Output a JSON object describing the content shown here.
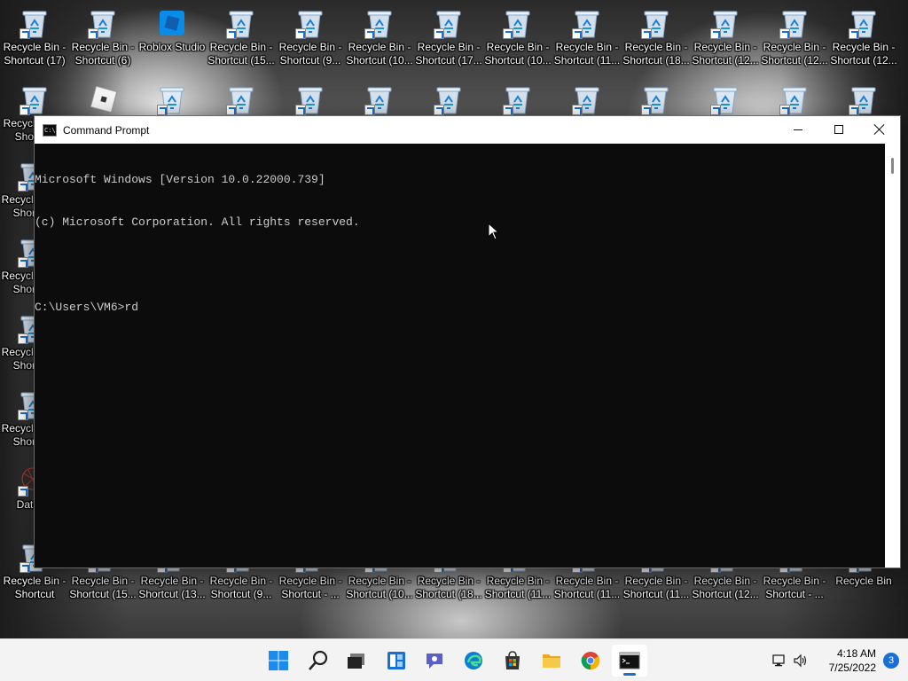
{
  "desktop": {
    "top_row": [
      {
        "label": "Recycle Bin -\nShortcut (17)",
        "icon": "recycle-bin-icon"
      },
      {
        "label": "Recycle Bin -\nShortcut (6)",
        "icon": "recycle-bin-icon"
      },
      {
        "label": "Roblox Studio",
        "icon": "roblox-studio-icon"
      },
      {
        "label": "Recycle Bin -\nShortcut (15...",
        "icon": "recycle-bin-icon"
      },
      {
        "label": "Recycle Bin -\nShortcut (9...",
        "icon": "recycle-bin-icon"
      },
      {
        "label": "Recycle Bin -\nShortcut (10...",
        "icon": "recycle-bin-icon"
      },
      {
        "label": "Recycle Bin -\nShortcut (17...",
        "icon": "recycle-bin-icon"
      },
      {
        "label": "Recycle Bin -\nShortcut (10...",
        "icon": "recycle-bin-icon"
      },
      {
        "label": "Recycle Bin -\nShortcut (11...",
        "icon": "recycle-bin-icon"
      },
      {
        "label": "Recycle Bin -\nShortcut (18...",
        "icon": "recycle-bin-icon"
      },
      {
        "label": "Recycle Bin -\nShortcut (12...",
        "icon": "recycle-bin-icon"
      },
      {
        "label": "Recycle Bin -\nShortcut (12...",
        "icon": "recycle-bin-icon"
      },
      {
        "label": "Recycle Bin -\nShortcut (12...",
        "icon": "recycle-bin-icon"
      }
    ],
    "second_row": [
      {
        "label": "Recycle Bin -\nShortcut",
        "icon": "recycle-bin-icon"
      },
      {
        "label": "",
        "icon": "roblox-player-icon"
      },
      {
        "label": "",
        "icon": "recycle-bin-icon"
      },
      {
        "label": "",
        "icon": "recycle-bin-icon"
      },
      {
        "label": "",
        "icon": "recycle-bin-icon"
      },
      {
        "label": "",
        "icon": "recycle-bin-icon"
      },
      {
        "label": "",
        "icon": "recycle-bin-icon"
      },
      {
        "label": "",
        "icon": "recycle-bin-icon"
      },
      {
        "label": "",
        "icon": "recycle-bin-icon"
      },
      {
        "label": "",
        "icon": "recycle-bin-icon"
      },
      {
        "label": "",
        "icon": "recycle-bin-icon"
      },
      {
        "label": "",
        "icon": "recycle-bin-icon"
      },
      {
        "label": "",
        "icon": "recycle-bin-icon"
      }
    ],
    "left_column": [
      {
        "label": "Recycle Bin -\nShortcut",
        "icon": "recycle-bin-icon"
      },
      {
        "label": "Recycle Bin -\nShortcut",
        "icon": "recycle-bin-icon"
      },
      {
        "label": "Recycle Bin -\nShortcut",
        "icon": "recycle-bin-icon"
      },
      {
        "label": "Recycle Bin -\nShortcut",
        "icon": "recycle-bin-icon"
      },
      {
        "label": "DataW",
        "icon": "datawrapper-icon"
      }
    ],
    "bottom_row": [
      {
        "label": "Recycle Bin -\nShortcut",
        "icon": "recycle-bin-icon"
      },
      {
        "label": "Recycle Bin -\nShortcut (15...",
        "icon": "recycle-bin-icon"
      },
      {
        "label": "Recycle Bin -\nShortcut (13...",
        "icon": "recycle-bin-icon"
      },
      {
        "label": "Recycle Bin -\nShortcut (9...",
        "icon": "recycle-bin-icon"
      },
      {
        "label": "Recycle Bin -\nShortcut - ...",
        "icon": "recycle-bin-icon"
      },
      {
        "label": "Recycle Bin -\nShortcut (10...",
        "icon": "recycle-bin-icon"
      },
      {
        "label": "Recycle Bin -\nShortcut (18...",
        "icon": "recycle-bin-icon"
      },
      {
        "label": "Recycle Bin -\nShortcut (11...",
        "icon": "recycle-bin-icon"
      },
      {
        "label": "Recycle Bin -\nShortcut (11...",
        "icon": "recycle-bin-icon"
      },
      {
        "label": "Recycle Bin -\nShortcut (11...",
        "icon": "recycle-bin-icon"
      },
      {
        "label": "Recycle Bin -\nShortcut (12...",
        "icon": "recycle-bin-icon"
      },
      {
        "label": "Recycle Bin -\nShortcut - ...",
        "icon": "recycle-bin-icon"
      },
      {
        "label": "Recycle Bin",
        "icon": "recycle-bin-icon"
      }
    ]
  },
  "cmd": {
    "title": "Command Prompt",
    "app_icon_text": "C:\\",
    "lines": [
      "Microsoft Windows [Version 10.0.22000.739]",
      "(c) Microsoft Corporation. All rights reserved.",
      "",
      "C:\\Users\\VM6>rd"
    ],
    "minimize_icon": "minimize-icon",
    "maximize_icon": "maximize-icon",
    "close_icon": "close-icon"
  },
  "taskbar": {
    "items": [
      {
        "name": "start-button",
        "icon": "windows-start-icon",
        "active": false
      },
      {
        "name": "search-button",
        "icon": "search-icon",
        "active": false
      },
      {
        "name": "task-view-button",
        "icon": "task-view-icon",
        "active": false
      },
      {
        "name": "widgets-button",
        "icon": "widgets-icon",
        "active": false
      },
      {
        "name": "chat-button",
        "icon": "teams-chat-icon",
        "active": false
      },
      {
        "name": "edge-button",
        "icon": "edge-icon",
        "active": false
      },
      {
        "name": "store-button",
        "icon": "microsoft-store-icon",
        "active": false
      },
      {
        "name": "file-explorer-button",
        "icon": "folder-icon",
        "active": false
      },
      {
        "name": "chrome-button",
        "icon": "chrome-icon",
        "active": false
      },
      {
        "name": "terminal-button",
        "icon": "command-prompt-icon",
        "active": true
      }
    ],
    "tray": {
      "network_icon": "network-icon",
      "volume_icon": "volume-icon",
      "time": "4:18 AM",
      "date": "7/25/2022",
      "notification_count": "3"
    }
  },
  "colors": {
    "accent": "#1a6fd4",
    "console_bg": "#0c0c0c",
    "console_text": "#cccccc",
    "taskbar_bg": "#f3f3f3"
  }
}
